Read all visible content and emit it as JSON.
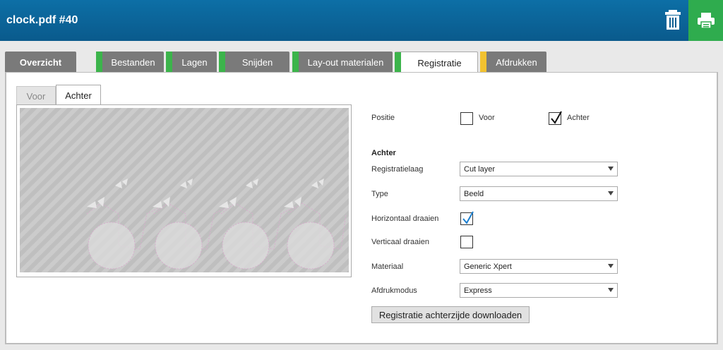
{
  "header": {
    "title": "clock.pdf #40",
    "trash_icon": "trash-icon",
    "print_icon": "printer-icon",
    "print_bg": "#2fac4e"
  },
  "tabs": [
    {
      "label": "Overzicht",
      "stripe": ""
    },
    {
      "label": "Bestanden",
      "stripe": "#3cb44b"
    },
    {
      "label": "Lagen",
      "stripe": "#3cb44b"
    },
    {
      "label": "Snijden",
      "stripe": "#3cb44b"
    },
    {
      "label": "Lay-out materialen",
      "stripe": "#3cb44b"
    },
    {
      "label": "Registratie",
      "stripe": "#3cb44b",
      "active": true
    },
    {
      "label": "Afdrukken",
      "stripe": "#f2c230"
    }
  ],
  "subtabs": {
    "voor": "Voor",
    "achter": "Achter"
  },
  "form": {
    "positie_label": "Positie",
    "positie_voor": "Voor",
    "positie_achter": "Achter",
    "positie_voor_checked": false,
    "positie_achter_checked": true,
    "section_title": "Achter",
    "registratielaag_label": "Registratielaag",
    "registratielaag_value": "Cut layer",
    "type_label": "Type",
    "type_value": "Beeld",
    "horizontaal_label": "Horizontaal draaien",
    "horizontaal_checked": true,
    "verticaal_label": "Verticaal draaien",
    "verticaal_checked": false,
    "materiaal_label": "Materiaal",
    "materiaal_value": "Generic Xpert",
    "afdrukmodus_label": "Afdrukmodus",
    "afdrukmodus_value": "Express",
    "download_button": "Registratie achterzijde downloaden"
  }
}
